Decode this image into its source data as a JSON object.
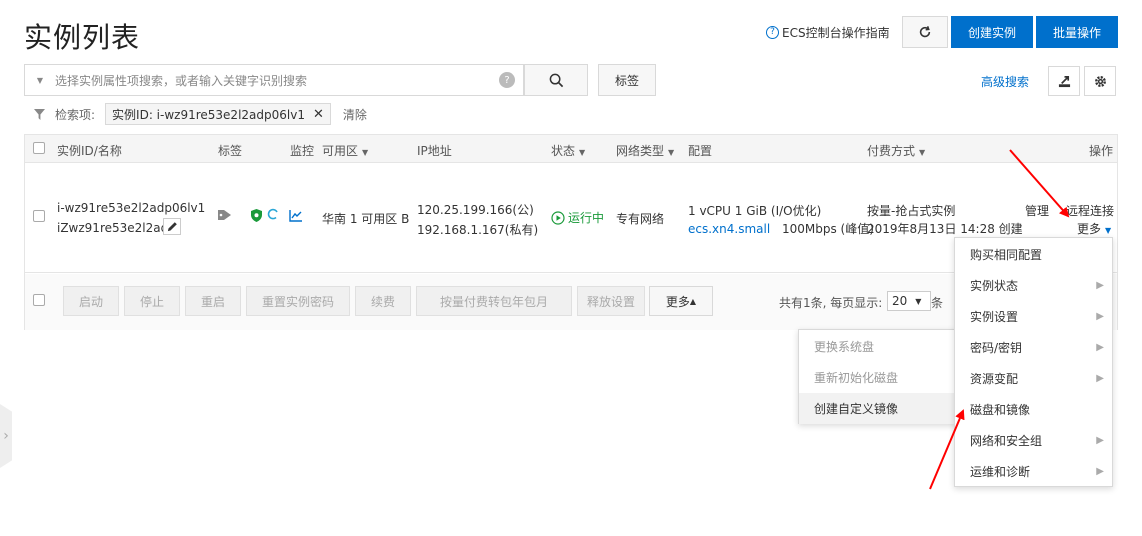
{
  "header": {
    "title": "实例列表",
    "guide_icon": "?",
    "guide_link": "ECS控制台操作指南",
    "refresh_icon": "refresh-icon",
    "create_btn": "创建实例",
    "batch_btn": "批量操作"
  },
  "search": {
    "placeholder": "选择实例属性项搜索，或者输入关键字识别搜索",
    "help_icon": "?",
    "tag_btn": "标签",
    "advanced_link": "高级搜索"
  },
  "filter": {
    "label": "检索项:",
    "tag_text": "实例ID: i-wz91re53e2l2adp06lv1",
    "clear": "清除"
  },
  "table": {
    "headers": {
      "id_name": "实例ID/名称",
      "tag": "标签",
      "monitor": "监控",
      "zone": "可用区",
      "ip": "IP地址",
      "status": "状态",
      "network": "网络类型",
      "config": "配置",
      "billing": "付费方式",
      "ops": "操作"
    },
    "row": {
      "instance_id": "i-wz91re53e2l2adp06lv1",
      "instance_name": "iZwz91re53e2l2ad...",
      "zone": "华南 1 可用区 B",
      "ip_public": "120.25.199.166(公)",
      "ip_private": "192.168.1.167(私有)",
      "status": "运行中",
      "network": "专有网络",
      "config_line1": "1 vCPU 1 GiB (I/O优化)",
      "config_type": "ecs.xn4.small",
      "config_bandwidth": "100Mbps (峰值)",
      "billing_line1": "按量-抢占式实例",
      "billing_line2": "2019年8月13日 14:28 创建",
      "op_manage": "管理",
      "op_remote": "远程连接",
      "op_more": "更多"
    }
  },
  "footer": {
    "buttons": [
      "启动",
      "停止",
      "重启",
      "重置实例密码",
      "续费",
      "按量付费转包年包月",
      "释放设置"
    ],
    "more_btn": "更多",
    "pagination_text": "共有1条, 每页显示:",
    "page_size": "20",
    "page_suffix": "条"
  },
  "more_menu": [
    {
      "label": "购买相同配置",
      "submenu": false
    },
    {
      "label": "实例状态",
      "submenu": true
    },
    {
      "label": "实例设置",
      "submenu": true
    },
    {
      "label": "密码/密钥",
      "submenu": true
    },
    {
      "label": "资源变配",
      "submenu": true
    },
    {
      "label": "磁盘和镜像",
      "submenu": false
    },
    {
      "label": "网络和安全组",
      "submenu": true
    },
    {
      "label": "运维和诊断",
      "submenu": true
    }
  ],
  "submenu": [
    {
      "label": "更换系统盘",
      "disabled": true
    },
    {
      "label": "重新初始化磁盘",
      "disabled": true
    },
    {
      "label": "创建自定义镜像",
      "disabled": false
    }
  ],
  "colors": {
    "primary": "#0070cc",
    "running": "#1a9a3a",
    "annotation": "#ff0000"
  }
}
